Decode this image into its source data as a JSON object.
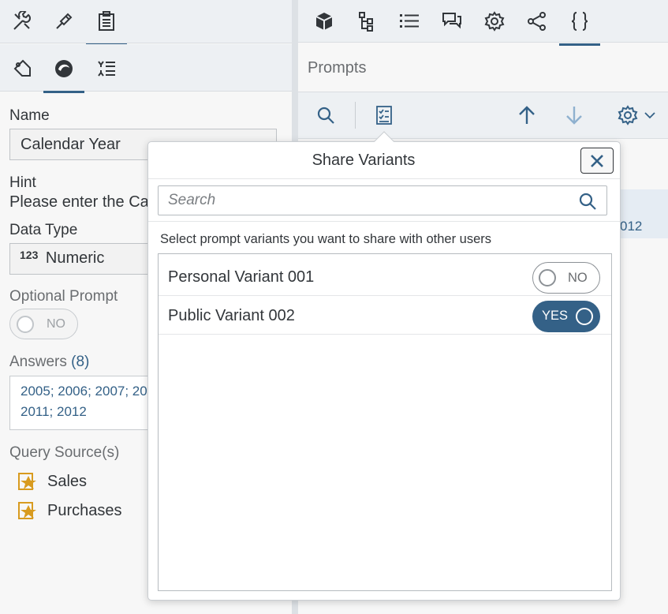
{
  "left_panel": {
    "name_label": "Name",
    "name_value": "Calendar Year",
    "hint_label": "Hint",
    "hint_value": "Please enter the Ca",
    "data_type_label": "Data Type",
    "data_type_badge": "123",
    "data_type_value": "Numeric",
    "optional_label": "Optional Prompt",
    "optional_toggle": "NO",
    "answers_label": "Answers",
    "answers_count": "(8)",
    "answers_line1": "2005; 2006; 2007; 20",
    "answers_line2": "2011; 2012",
    "query_source_label": "Query Source(s)",
    "query_sources": [
      "Sales",
      "Purchases"
    ]
  },
  "right_panel": {
    "title": "Prompts",
    "row_partial_text": "012"
  },
  "popover": {
    "title": "Share Variants",
    "search_placeholder": "Search",
    "instruction": "Select prompt variants you want to share with other users",
    "variants": [
      {
        "name": "Personal Variant 001",
        "state": "NO"
      },
      {
        "name": "Public Variant 002",
        "state": "YES"
      }
    ]
  },
  "colors": {
    "accent": "#346187",
    "toolbar_bg": "#edf0f3",
    "icon_gold": "#d89b1f"
  }
}
